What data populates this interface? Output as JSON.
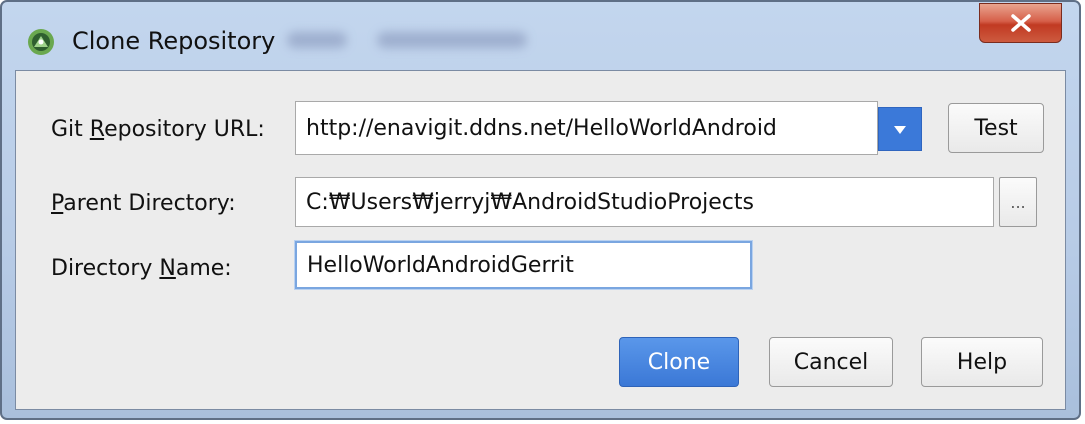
{
  "window": {
    "title": "Clone Repository",
    "icons": {
      "app": "android-studio-icon",
      "close": "close-icon"
    }
  },
  "form": {
    "repo_url": {
      "label_pre": "Git ",
      "label_mnemonic": "R",
      "label_post": "epository URL:",
      "value": "http://enavigit.ddns.net/HelloWorldAndroid",
      "dropdown_icon": "chevron-down-icon",
      "test_label": "Test"
    },
    "parent_dir": {
      "label_mnemonic": "P",
      "label_post": "arent Directory:",
      "value": "C:₩Users₩jerryj₩AndroidStudioProjects",
      "browse_label": "..."
    },
    "dir_name": {
      "label_pre": "Directory ",
      "label_mnemonic": "N",
      "label_post": "ame:",
      "value": "HelloWorldAndroidGerrit"
    }
  },
  "buttons": {
    "clone": "Clone",
    "cancel": "Cancel",
    "help": "Help"
  },
  "colors": {
    "accent": "#3b79d9",
    "titlebar": "#b7cbe6",
    "close": "#c94a32"
  }
}
